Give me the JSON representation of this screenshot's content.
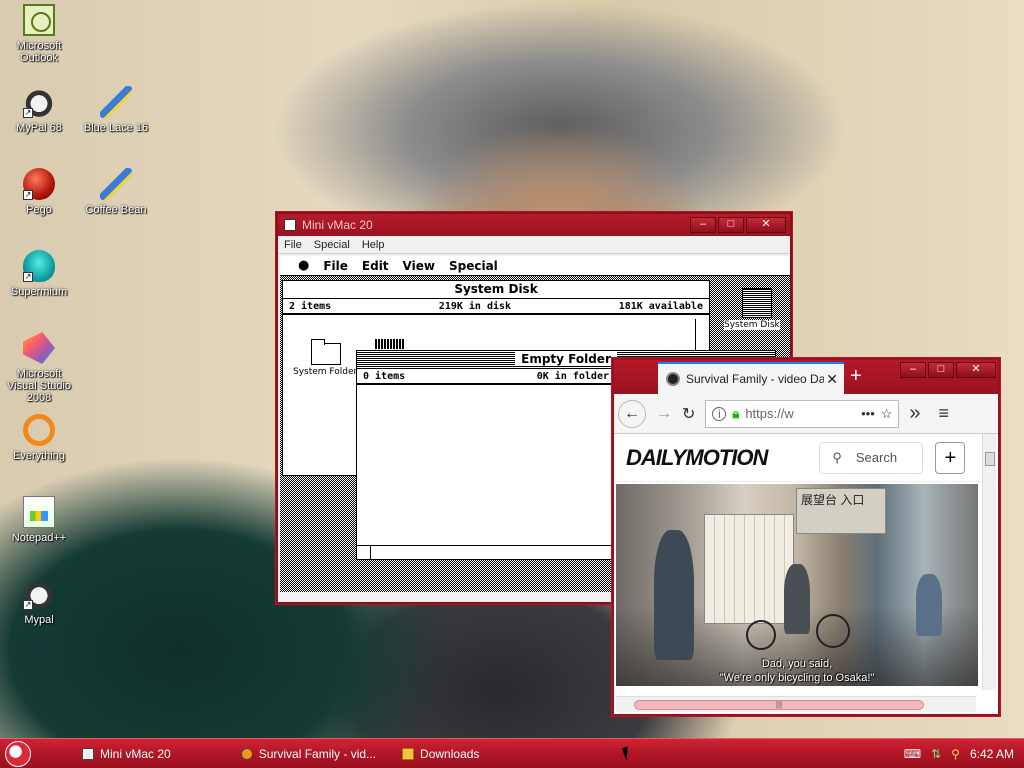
{
  "desktop": {
    "icons": [
      {
        "label": "Microsoft Outlook",
        "icon": "outlook-icon"
      },
      {
        "label": "MyPal 68",
        "icon": "raccoon-icon",
        "shortcut": true
      },
      {
        "label": "Blue Lace 16",
        "icon": "paintbrush-icon"
      },
      {
        "label": "Pego",
        "icon": "pego-icon",
        "shortcut": true
      },
      {
        "label": "Coffee Bean",
        "icon": "paintbrush-icon"
      },
      {
        "label": "Supermium",
        "icon": "supermium-icon",
        "shortcut": true
      },
      {
        "label": "Microsoft Visual Studio 2008",
        "icon": "visual-studio-icon",
        "shortcut": true
      },
      {
        "label": "Everything",
        "icon": "everything-icon",
        "shortcut": true
      },
      {
        "label": "Notepad++",
        "icon": "notepad-plus-plus-icon",
        "shortcut": true
      },
      {
        "label": "Mypal",
        "icon": "raccoon-icon",
        "shortcut": true
      }
    ]
  },
  "minivmac": {
    "title": "Mini vMac 20",
    "menu": [
      "File",
      "Special",
      "Help"
    ],
    "buttons": {
      "minimize": "–",
      "maximize": "□",
      "close": "✕"
    },
    "mac_menu": {
      "apple": "",
      "items": [
        "File",
        "Edit",
        "View",
        "Special"
      ]
    },
    "system_disk": {
      "title": "System Disk",
      "items": "2 items",
      "in_disk": "219K in disk",
      "available": "181K available",
      "folder_label": "System Folder"
    },
    "desktop_disk_label": "System Disk",
    "empty_folder": {
      "title": "Empty Folder",
      "items": "0 items",
      "in_folder": "0K in folder"
    }
  },
  "firefox": {
    "tab_title": "Survival Family - video Dail",
    "tab_close": "✕",
    "new_tab": "+",
    "buttons": {
      "minimize": "–",
      "maximize": "□",
      "close": "✕"
    },
    "url": "https://w",
    "url_more": "•••",
    "overflow": "»",
    "menu": "≡",
    "site": {
      "logo": "DAILYMOTION",
      "search_label": "Search",
      "plus": "+"
    },
    "video": {
      "subtitle_line1": "Dad, you said,",
      "subtitle_line2": "\"We're only bicycling to Osaka!\"",
      "sign_text": "展望台 入口"
    }
  },
  "taskbar": {
    "tasks": [
      {
        "label": "Mini vMac 20"
      },
      {
        "label": "Survival Family - vid..."
      },
      {
        "label": "Downloads"
      }
    ],
    "clock": "6:42 AM"
  }
}
